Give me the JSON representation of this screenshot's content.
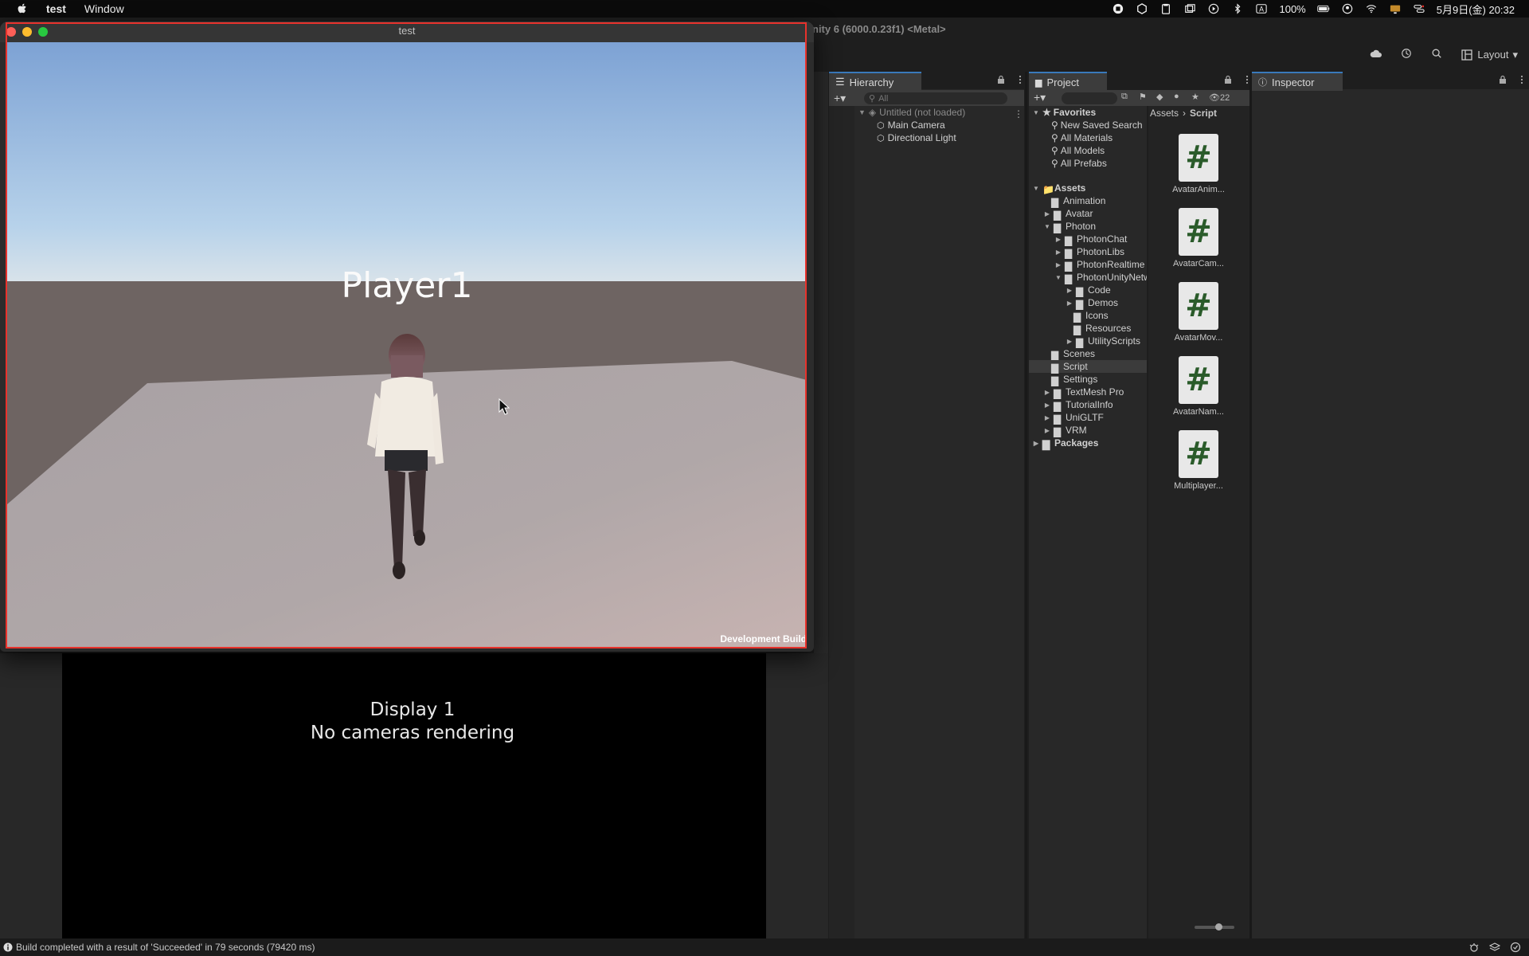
{
  "menubar": {
    "app_name": "test",
    "menu_window": "Window",
    "battery": "100%",
    "date_time": "5月9日(金) 20:32"
  },
  "unity": {
    "title_fragment": "nity 6 (6000.0.23f1) <Metal>",
    "layout_label": "Layout"
  },
  "hierarchy": {
    "tab_label": "Hierarchy",
    "search_placeholder": "All",
    "scene_name": "Untitled (not loaded)",
    "items": [
      "Main Camera",
      "Directional Light"
    ]
  },
  "project": {
    "tab_label": "Project",
    "badge_count": "22",
    "favorites_label": "Favorites",
    "favorites": [
      "New Saved Search",
      "All Materials",
      "All Models",
      "All Prefabs"
    ],
    "assets_label": "Assets",
    "assets": [
      "Animation",
      "Avatar",
      "Photon",
      "PhotonChat",
      "PhotonLibs",
      "PhotonRealtime",
      "PhotonUnityNetworking",
      "Code",
      "Demos",
      "Icons",
      "Resources",
      "UtilityScripts",
      "Scenes",
      "Script",
      "Settings",
      "TextMesh Pro",
      "TutorialInfo",
      "UniGLTF",
      "VRM"
    ],
    "packages_label": "Packages",
    "breadcrumb": [
      "Assets",
      "Script"
    ],
    "files": [
      "AvatarAnim...",
      "AvatarCam...",
      "AvatarMov...",
      "AvatarNam...",
      "Multiplayer..."
    ]
  },
  "inspector": {
    "tab_label": "Inspector"
  },
  "gameview": {
    "display_label": "Display 1",
    "no_camera_text": "No cameras rendering"
  },
  "statusbar": {
    "message": "Build completed with a result of 'Succeeded' in 79 seconds (79420 ms)"
  },
  "player_window": {
    "title": "test",
    "player_name": "Player1",
    "dev_build": "Development Build"
  },
  "colors": {
    "accent_red_frame": "#e8322c",
    "tab_accent": "#3a79bb"
  }
}
